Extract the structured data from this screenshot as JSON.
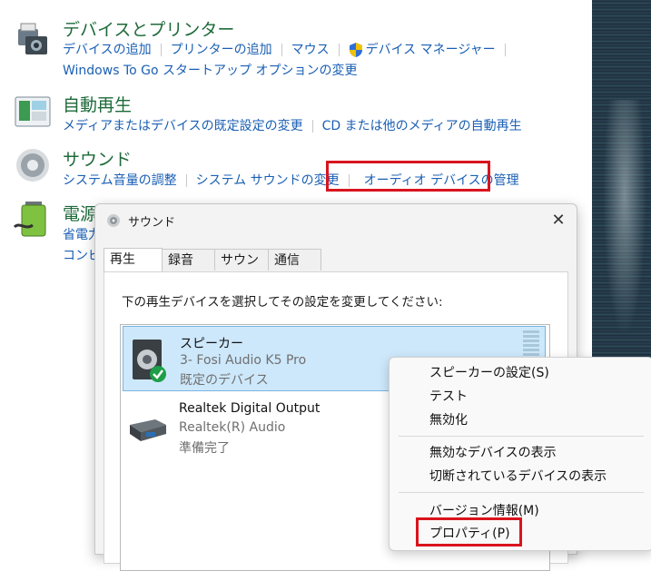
{
  "control_panel": {
    "devices": {
      "title": "デバイスとプリンター",
      "links": [
        "デバイスの追加",
        "プリンターの追加",
        "マウス",
        "デバイス マネージャー"
      ],
      "link2": "Windows To Go スタートアップ オプションの変更"
    },
    "autoplay": {
      "title": "自動再生",
      "links": [
        "メディアまたはデバイスの既定設定の変更",
        "CD または他のメディアの自動再生"
      ]
    },
    "sound": {
      "title": "サウンド",
      "links": [
        "システム音量の調整",
        "システム サウンドの変更",
        "オーディオ デバイスの管理"
      ]
    },
    "power": {
      "title": "電源オ",
      "link1": "省電力",
      "link2": "コンピ"
    }
  },
  "dialog": {
    "title": "サウンド",
    "close": "✕",
    "tabs": [
      "再生",
      "録音",
      "サウンド",
      "通信"
    ],
    "instruction": "下の再生デバイスを選択してその設定を変更してください:",
    "devices": [
      {
        "name": "スピーカー",
        "detail": "3- Fosi Audio K5 Pro",
        "status": "既定のデバイス"
      },
      {
        "name": "Realtek Digital Output",
        "detail": "Realtek(R) Audio",
        "status": "準備完了"
      }
    ]
  },
  "context_menu": {
    "items": [
      "スピーカーの設定(S)",
      "テスト",
      "無効化",
      "無効なデバイスの表示",
      "切断されているデバイスの表示",
      "バージョン情報(M)",
      "プロパティ(P)"
    ]
  },
  "colors": {
    "highlight_box": "#d9141e",
    "link": "#1a5fb4",
    "category_title": "#1e6a3a",
    "selected_row": "#cde8fb"
  }
}
